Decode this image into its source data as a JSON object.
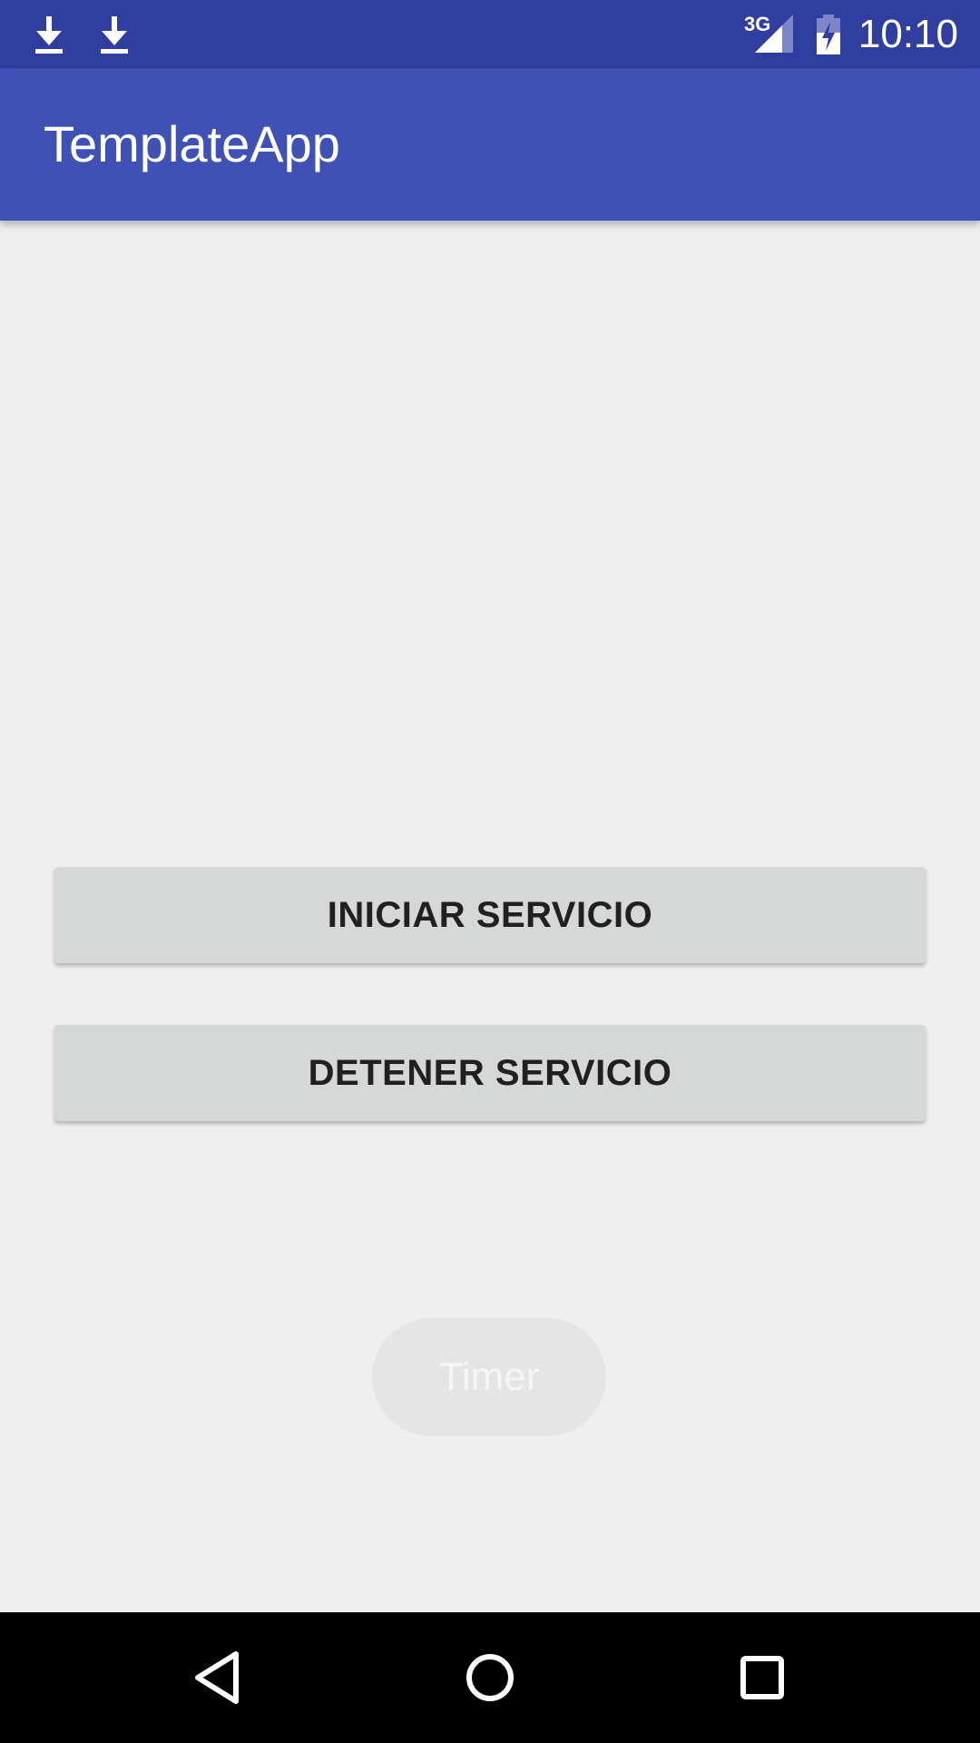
{
  "status_bar": {
    "network": "3G",
    "time": "10:10",
    "icons": [
      "download-icon",
      "download-icon",
      "signal-icon",
      "battery-charging-icon"
    ]
  },
  "app_bar": {
    "title": "TemplateApp"
  },
  "main": {
    "start_service_label": "INICIAR SERVICIO",
    "stop_service_label": "DETENER SERVICIO",
    "timer_label": "Timer"
  },
  "nav_bar": {
    "icons": [
      "back-icon",
      "home-icon",
      "recents-icon"
    ]
  },
  "colors": {
    "status_bar": "#303f9f",
    "app_bar": "#3f51b5",
    "background": "#efefef",
    "button": "#d6d7d7"
  }
}
